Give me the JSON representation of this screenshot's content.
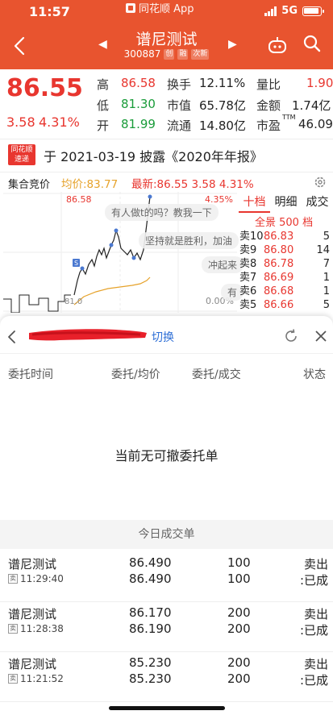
{
  "status_bar": {
    "time": "11:57",
    "app_name": "同花顺 App",
    "network": "5G"
  },
  "header": {
    "stock_name": "谱尼测试",
    "stock_code": "300887",
    "tags": [
      "创",
      "融",
      "次新"
    ],
    "accent_color": "#e8542f"
  },
  "quote": {
    "price": "86.55",
    "change": "3.58",
    "change_pct": "4.31%",
    "fields": {
      "high_label": "高",
      "high": "86.58",
      "low_label": "低",
      "low": "81.30",
      "open_label": "开",
      "open": "81.99",
      "turnover_label": "换手",
      "turnover": "12.11%",
      "mcap_label": "市值",
      "mcap": "65.78亿",
      "float_label": "流通",
      "float": "14.80亿",
      "volratio_label": "量比",
      "volratio": "1.90",
      "amount_label": "金额",
      "amount": "1.74亿",
      "pe_label": "市盈",
      "pe_sup": "TTM",
      "pe": "46.09"
    }
  },
  "news": {
    "logo_line1": "同花顺",
    "logo_line2": "速递",
    "text": "于 2021-03-19 披露《2020年年报》"
  },
  "chart_header": {
    "auction_label": "集合竞价",
    "avg_label": "均价:83.77",
    "last_label": "最新:86.55  3.58  4.31%",
    "top_price": "86.58",
    "top_pct": "4.35%",
    "zero_pct": "0.00%",
    "left_mark": "81.0"
  },
  "danmu": [
    "有人做t的吗？教我一下",
    "坚持就是胜利，加油",
    "冲起来",
    "有"
  ],
  "order_book": {
    "tabs": [
      "十档",
      "明细",
      "成交"
    ],
    "sub": "全景 500 档",
    "rows": [
      {
        "label": "卖10",
        "price": "86.83",
        "vol": "5"
      },
      {
        "label": "卖9",
        "price": "86.80",
        "vol": "14"
      },
      {
        "label": "卖8",
        "price": "86.78",
        "vol": "7"
      },
      {
        "label": "卖7",
        "price": "86.69",
        "vol": "1"
      },
      {
        "label": "卖6",
        "price": "86.68",
        "vol": "1"
      },
      {
        "label": "卖5",
        "price": "86.66",
        "vol": "5"
      }
    ]
  },
  "sheet": {
    "switch_label": "切换",
    "columns": {
      "time": "委托时间",
      "price": "委托/均价",
      "qty": "委托/成交",
      "status": "状态"
    },
    "empty_message": "当前无可撤委托单",
    "today_title": "今日成交单",
    "trades": [
      {
        "name": "谱尼测试",
        "tag": "卖",
        "time": "11:29:40",
        "price1": "86.490",
        "price2": "86.490",
        "qty1": "100",
        "qty2": "100",
        "status1": "卖出",
        "status2": ":已成"
      },
      {
        "name": "谱尼测试",
        "tag": "卖",
        "time": "11:28:38",
        "price1": "86.170",
        "price2": "86.190",
        "qty1": "200",
        "qty2": "200",
        "status1": "卖出",
        "status2": ":已成"
      },
      {
        "name": "谱尼测试",
        "tag": "卖",
        "time": "11:21:52",
        "price1": "85.230",
        "price2": "85.230",
        "qty1": "200",
        "qty2": "200",
        "status1": "卖出",
        "status2": ":已成"
      }
    ]
  }
}
